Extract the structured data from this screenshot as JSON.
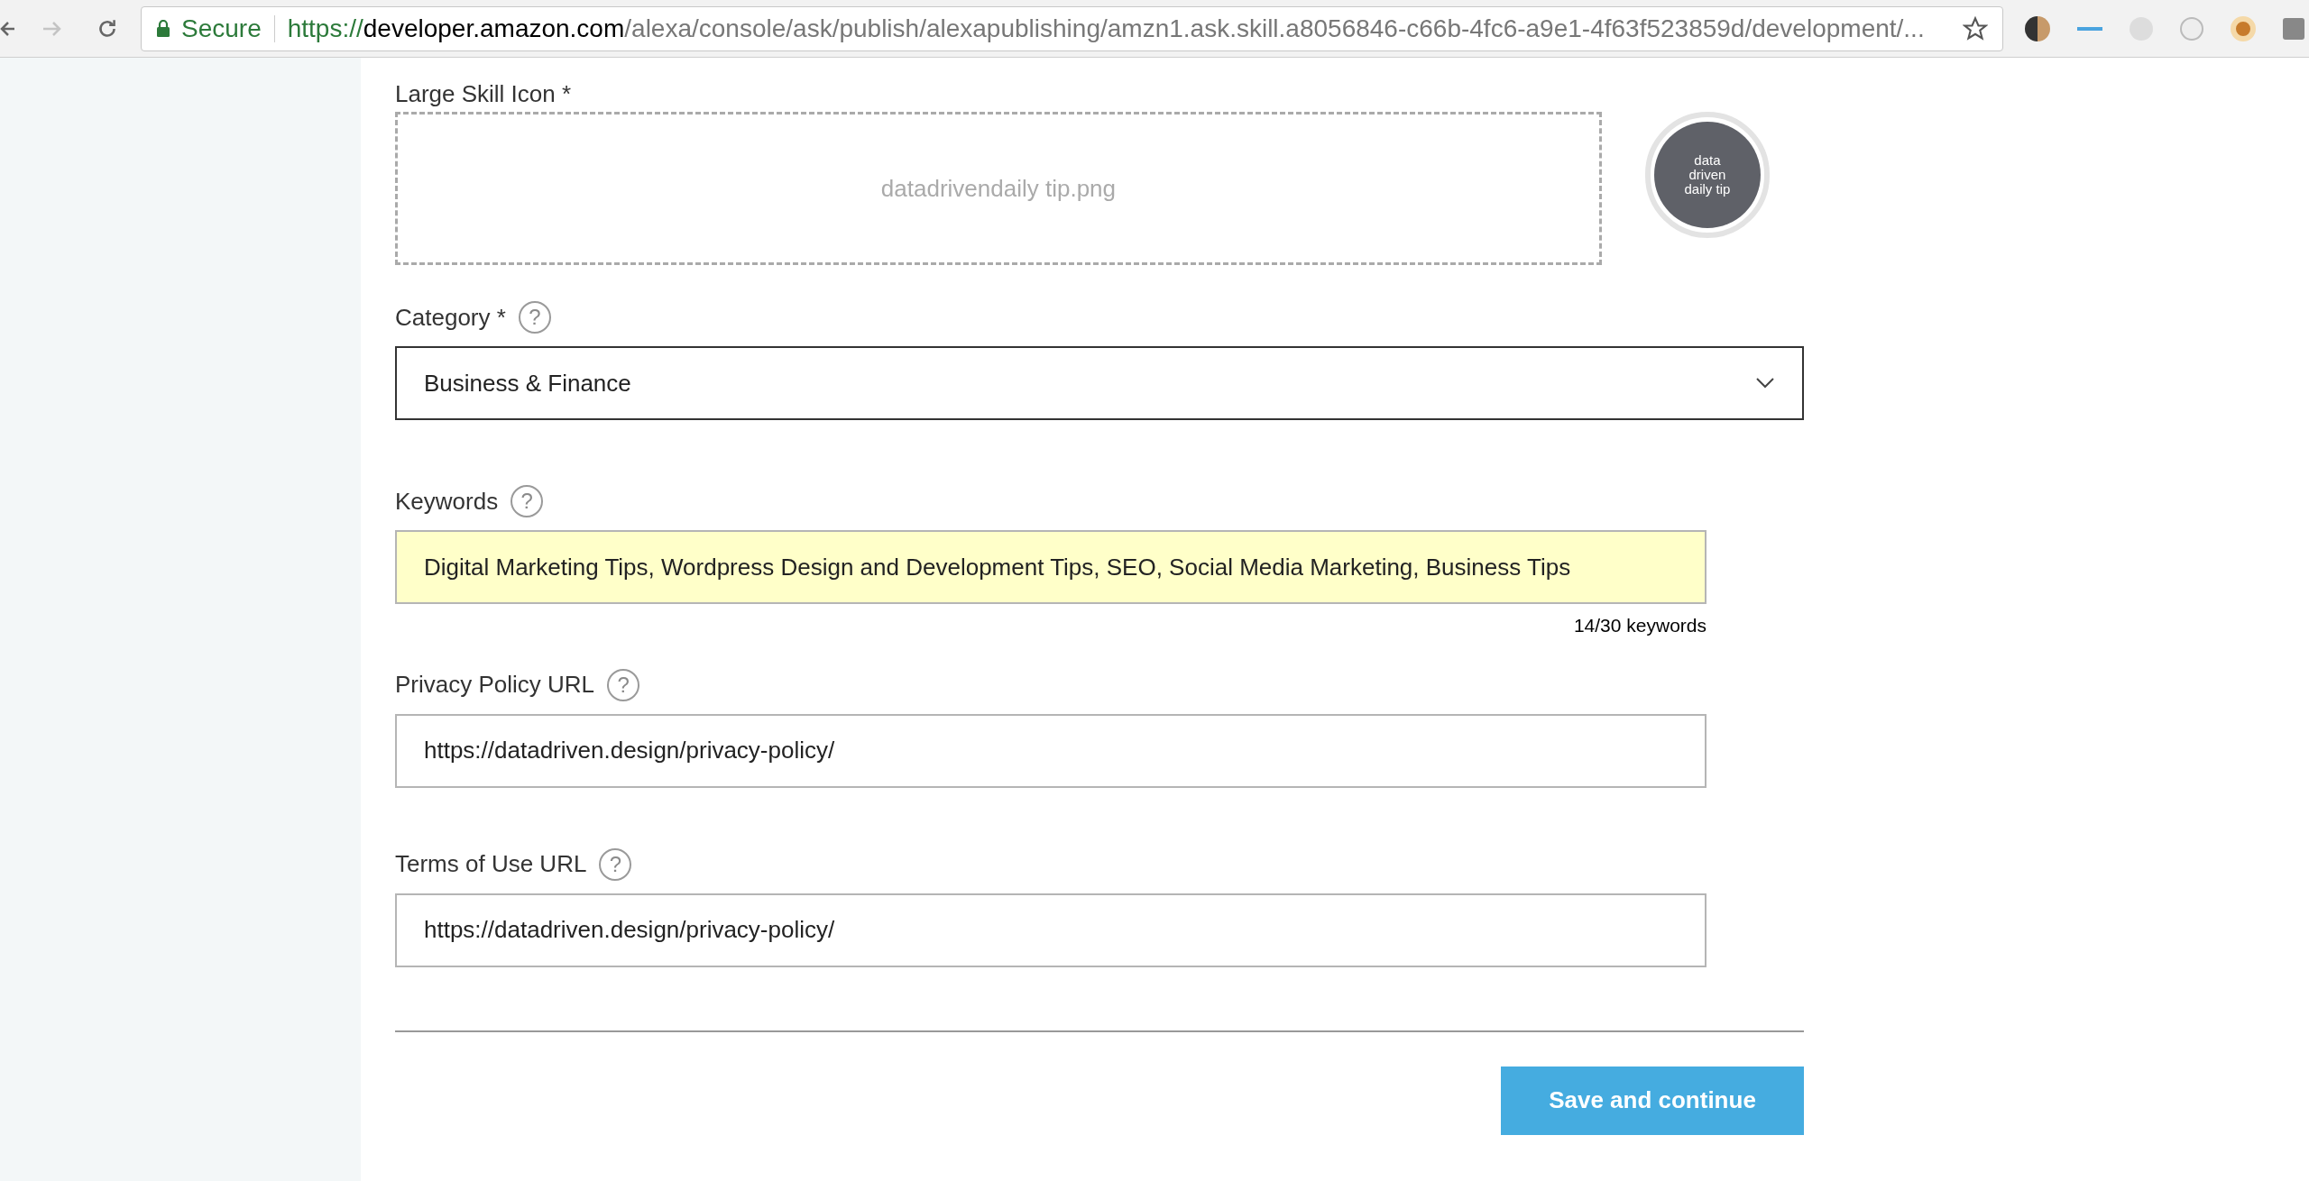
{
  "browser": {
    "secure_label": "Secure",
    "url_scheme": "https://",
    "url_host": "developer.amazon.com",
    "url_path": "/alexa/console/ask/publish/alexapublishing/amzn1.ask.skill.a8056846-c66b-4fc6-a9e1-4f63f523859d/development/..."
  },
  "large_icon": {
    "label": "Large Skill Icon *",
    "file_name": "datadrivendaily tip.png",
    "preview_text": "data driven daily tip"
  },
  "category": {
    "label": "Category *",
    "value": "Business & Finance"
  },
  "keywords": {
    "label": "Keywords",
    "value": "Digital Marketing Tips, Wordpress Design and Development Tips, SEO, Social Media Marketing, Business Tips",
    "count": "14/30 keywords",
    "autofilled": true
  },
  "privacy": {
    "label": "Privacy Policy URL",
    "value": "https://datadriven.design/privacy-policy/"
  },
  "terms": {
    "label": "Terms of Use URL",
    "value": "https://datadriven.design/privacy-policy/"
  },
  "help_glyph": "?",
  "save_button": "Save and continue"
}
